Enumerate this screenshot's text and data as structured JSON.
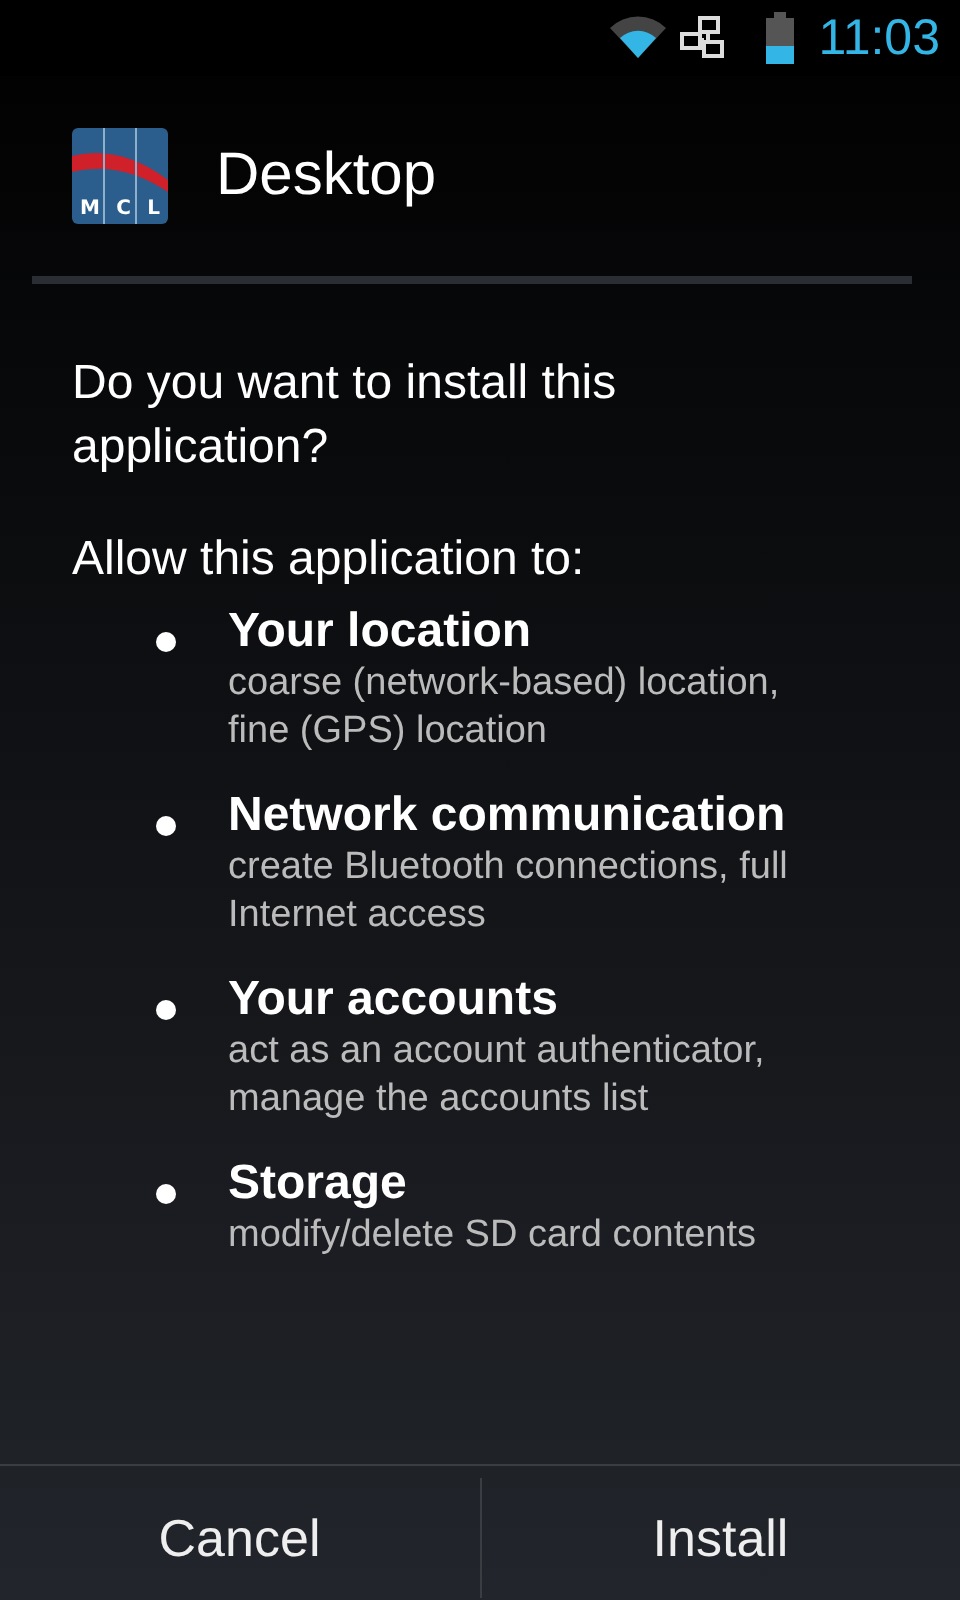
{
  "status_bar": {
    "time": "11:03"
  },
  "header": {
    "title": "Desktop",
    "icon_letters": [
      "M",
      "C",
      "L"
    ]
  },
  "question": "Do you want to install this application?",
  "permissions_heading": "Allow this application to:",
  "permissions": [
    {
      "title": "Your location",
      "description": "coarse (network-based) location, fine (GPS) location"
    },
    {
      "title": "Network communication",
      "description": "create Bluetooth connections, full Internet access"
    },
    {
      "title": "Your accounts",
      "description": "act as an account authenticator, manage the accounts list"
    },
    {
      "title": "Storage",
      "description": "modify/delete SD card contents"
    }
  ],
  "buttons": [
    "Cancel",
    "Install"
  ]
}
